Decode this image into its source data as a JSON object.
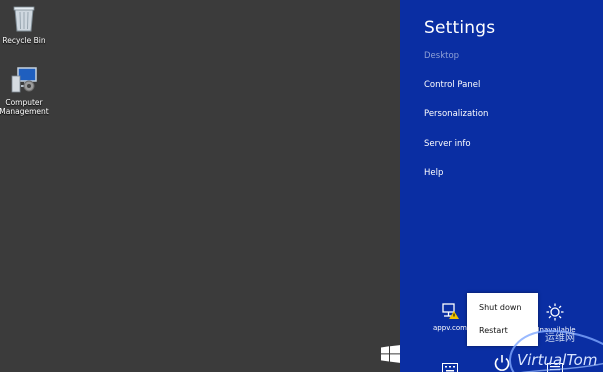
{
  "desktop": {
    "icons": [
      {
        "label": "Recycle Bin",
        "icon": "recycle-bin-icon"
      },
      {
        "label": "Computer Management",
        "icon": "computer-management-icon"
      }
    ]
  },
  "charm": {
    "title": "Settings",
    "items": [
      {
        "label": "Desktop",
        "enabled": false
      },
      {
        "label": "Control Panel",
        "enabled": true
      },
      {
        "label": "Personalization",
        "enabled": true
      },
      {
        "label": "Server info",
        "enabled": true
      },
      {
        "label": "Help",
        "enabled": true
      }
    ],
    "tiles": [
      {
        "label": "appv.com",
        "icon": "network-warning-icon"
      },
      {
        "label": "Unavailable",
        "icon": "brightness-icon"
      }
    ],
    "bottom_icons": [
      "keyboard-icon",
      "power-icon",
      "language-icon"
    ]
  },
  "power_menu": {
    "options": [
      "Shut down",
      "Restart"
    ]
  },
  "watermark": {
    "cn": "运维网",
    "en": "VirtualTom"
  },
  "colors": {
    "charm_bg": "#0a2ea3",
    "desktop_bg": "#3b3b3b"
  }
}
